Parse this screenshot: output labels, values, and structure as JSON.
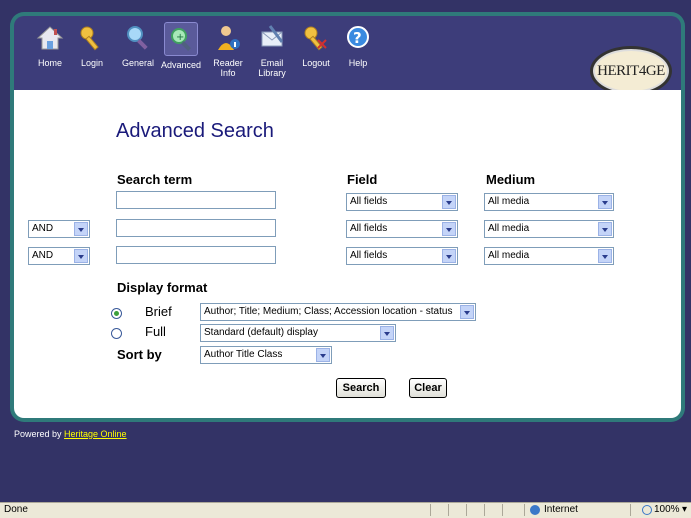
{
  "nav": {
    "items": [
      {
        "label": "Home",
        "icon": "home-icon"
      },
      {
        "label": "Login",
        "icon": "key-icon"
      },
      {
        "label": "General",
        "icon": "magnifier-icon"
      },
      {
        "label": "Advanced",
        "icon": "advanced-search-icon"
      },
      {
        "label": "Reader Info",
        "icon": "reader-icon"
      },
      {
        "label": "Email Library",
        "icon": "email-icon"
      },
      {
        "label": "Logout",
        "icon": "logout-key-icon"
      },
      {
        "label": "Help",
        "icon": "help-icon"
      }
    ],
    "logo_text": "HERIT4GE"
  },
  "form": {
    "title": "Advanced Search",
    "search_term_label": "Search term",
    "field_label": "Field",
    "medium_label": "Medium",
    "rows": [
      {
        "operator": "",
        "term": "",
        "field": "All fields",
        "medium": "All media"
      },
      {
        "operator": "AND",
        "term": "",
        "field": "All fields",
        "medium": "All media"
      },
      {
        "operator": "AND",
        "term": "",
        "field": "All fields",
        "medium": "All media"
      }
    ],
    "display_format_label": "Display format",
    "brief_label": "Brief",
    "brief_value": "Author; Title; Medium; Class; Accession location - status",
    "full_label": "Full",
    "full_value": "Standard (default) display",
    "selected_format": "Brief",
    "sort_by_label": "Sort by",
    "sort_by_value": "Author Title Class",
    "search_button": "Search",
    "clear_button": "Clear"
  },
  "footer": {
    "powered_prefix": "Powered by ",
    "powered_link": "Heritage Online"
  },
  "statusbar": {
    "status": "Done",
    "zone": "Internet",
    "zoom": "100%"
  },
  "colors": {
    "frame": "#2f7a7a",
    "toolbar": "#3d3d7a",
    "background": "#333366",
    "title": "#1a1a7a"
  }
}
